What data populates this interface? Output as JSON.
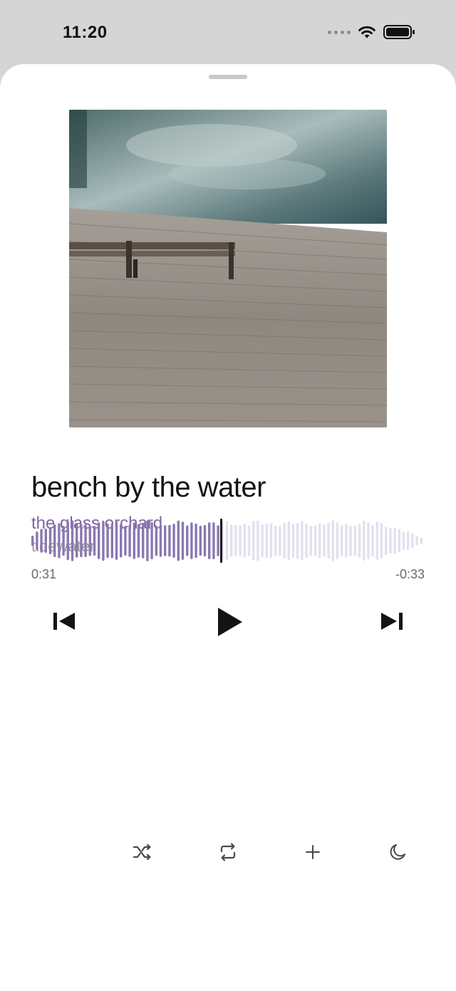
{
  "status_bar": {
    "time": "11:20"
  },
  "artwork": {
    "description_icon": "album-artwork-image"
  },
  "track": {
    "title": "bench by the water",
    "artist": "the glass orchard",
    "album": "tidewater"
  },
  "playback": {
    "elapsed": "0:31",
    "remaining": "-0:33",
    "progress": 0.484
  },
  "colors": {
    "accent": "#7a66a3",
    "played_wave": "#8a78b0",
    "unplayed_wave": "#e4e0ee",
    "text_primary": "#141414",
    "text_secondary": "#9b9b9b"
  },
  "controls": {
    "icons": [
      "previous-track-icon",
      "play-icon",
      "next-track-icon"
    ]
  },
  "bottom_bar": {
    "icons": [
      "shuffle-icon",
      "repeat-icon",
      "add-icon",
      "sleep-timer-icon"
    ]
  }
}
